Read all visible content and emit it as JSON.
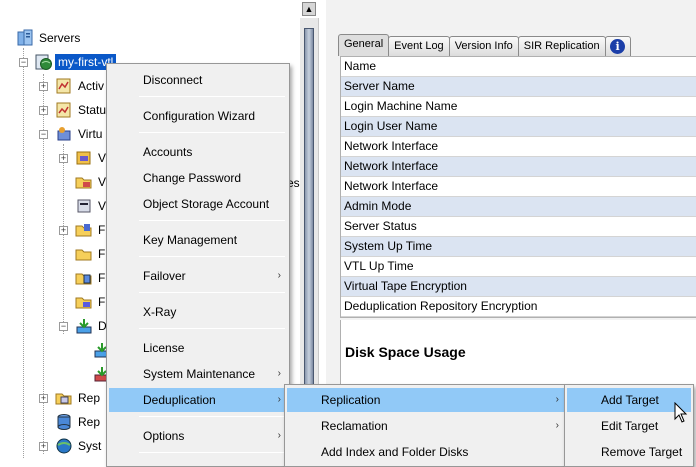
{
  "tree": {
    "root": "Servers",
    "server": "my-first-vtl",
    "items": [
      "Activ",
      "Statu",
      "Virtu",
      "V",
      "V",
      "V",
      "F",
      "F",
      "F",
      "F",
      "D",
      "Rep",
      "Rep",
      "Syst"
    ]
  },
  "tabs": [
    {
      "label": "General"
    },
    {
      "label": "Event Log"
    },
    {
      "label": "Version Info"
    },
    {
      "label": "SIR Replication"
    }
  ],
  "properties": {
    "header": "Name",
    "rows": [
      "Server Name",
      "Login Machine Name",
      "Login User Name",
      "Network Interface",
      "Network Interface",
      "Network Interface",
      "Admin Mode",
      "Server Status",
      "System Up Time",
      "VTL Up Time",
      "Virtual Tape Encryption",
      "Deduplication Repository Encryption"
    ]
  },
  "disk_space_title": "Disk Space Usage",
  "peek_text": "es",
  "context_menu": [
    {
      "label": "Disconnect"
    },
    {
      "label": "Configuration Wizard"
    },
    {
      "label": "Accounts"
    },
    {
      "label": "Change Password"
    },
    {
      "label": "Object Storage Account"
    },
    {
      "label": "Key Management"
    },
    {
      "label": "Failover",
      "submenu": true
    },
    {
      "label": "X-Ray"
    },
    {
      "label": "License"
    },
    {
      "label": "System Maintenance",
      "submenu": true
    },
    {
      "label": "Deduplication",
      "submenu": true
    },
    {
      "label": "Options",
      "submenu": true
    }
  ],
  "dedup_menu": [
    {
      "label": "Replication",
      "submenu": true
    },
    {
      "label": "Reclamation",
      "submenu": true
    },
    {
      "label": "Add Index and Folder Disks"
    }
  ],
  "replication_menu": [
    {
      "label": "Add Target"
    },
    {
      "label": "Edit Target"
    },
    {
      "label": "Remove Target"
    }
  ],
  "submenu_arrow": "›",
  "colors": {
    "menu_highlight": "#91c9f7",
    "tree_selection": "#0a58c8",
    "alt_row": "#dbe4f2"
  }
}
